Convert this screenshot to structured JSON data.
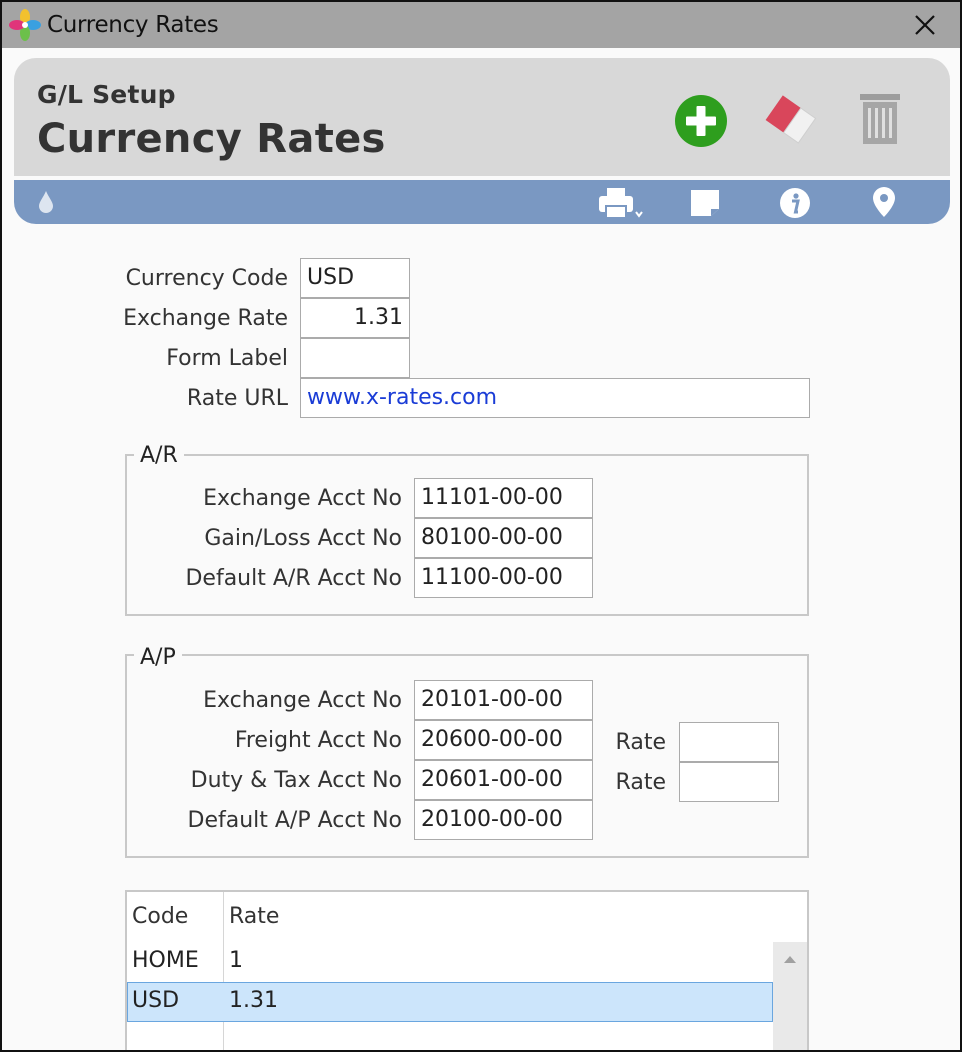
{
  "window": {
    "title": "Currency Rates"
  },
  "header": {
    "breadcrumb": "G/L Setup",
    "title": "Currency Rates",
    "actions": [
      {
        "name": "add-button",
        "icon": "plus-circle-icon",
        "color": "#2e9e1e"
      },
      {
        "name": "clear-button",
        "icon": "eraser-icon",
        "color": "#d9465b"
      },
      {
        "name": "delete-button",
        "icon": "trash-icon",
        "color": "#999999"
      }
    ]
  },
  "toolbar": {
    "icons": [
      "drop-icon",
      "print-icon",
      "note-icon",
      "info-icon",
      "location-pin-icon"
    ],
    "color": "#7a98c2"
  },
  "form": {
    "currency_code": {
      "label": "Currency Code",
      "value": "USD"
    },
    "exchange_rate": {
      "label": "Exchange Rate",
      "value": "1.31"
    },
    "form_label": {
      "label": "Form Label",
      "value": ""
    },
    "rate_url": {
      "label": "Rate URL",
      "value": "www.x-rates.com"
    }
  },
  "ar": {
    "title": "A/R",
    "exchange_acct": {
      "label": "Exchange Acct No",
      "value": "11101-00-00"
    },
    "gain_loss_acct": {
      "label": "Gain/Loss Acct No",
      "value": "80100-00-00"
    },
    "default_acct": {
      "label": "Default A/R Acct No",
      "value": "11100-00-00"
    }
  },
  "ap": {
    "title": "A/P",
    "exchange_acct": {
      "label": "Exchange Acct No",
      "value": "20101-00-00"
    },
    "freight_acct": {
      "label": "Freight Acct No",
      "value": "20600-00-00"
    },
    "duty_tax_acct": {
      "label": "Duty & Tax Acct No",
      "value": "20601-00-00"
    },
    "default_acct": {
      "label": "Default A/P Acct No",
      "value": "20100-00-00"
    },
    "freight_rate": {
      "label": "Rate",
      "value": ""
    },
    "duty_rate": {
      "label": "Rate",
      "value": ""
    }
  },
  "grid": {
    "columns": [
      "Code",
      "Rate"
    ],
    "rows": [
      {
        "code": "HOME",
        "rate": "1",
        "selected": false
      },
      {
        "code": "USD",
        "rate": "1.31",
        "selected": true
      }
    ],
    "selection_color": "#cce5fb"
  }
}
